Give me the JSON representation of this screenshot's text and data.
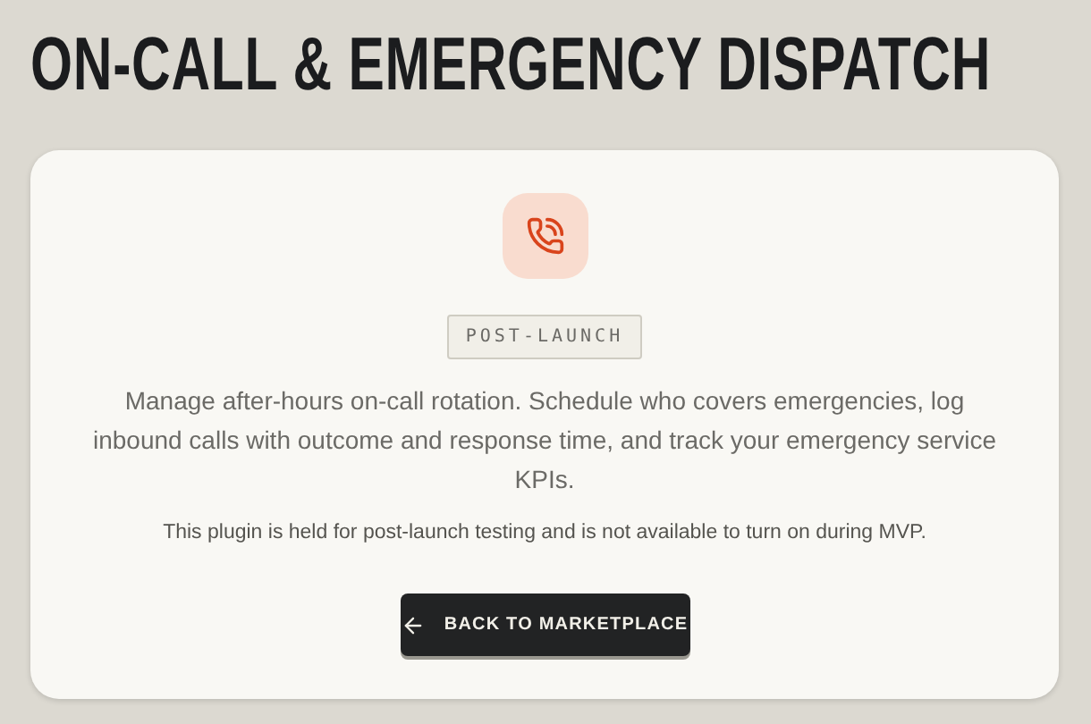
{
  "title": "ON-CALL & EMERGENCY DISPATCH",
  "card": {
    "badge": "POST-LAUNCH",
    "description": "Manage after-hours on-call rotation. Schedule who covers emergencies, log inbound calls with outcome and response time, and track your emergency service KPIs.",
    "note": "This plugin is held for post-launch testing and is not available to turn on during MVP.",
    "button": "BACK TO MARKETPLACE"
  }
}
